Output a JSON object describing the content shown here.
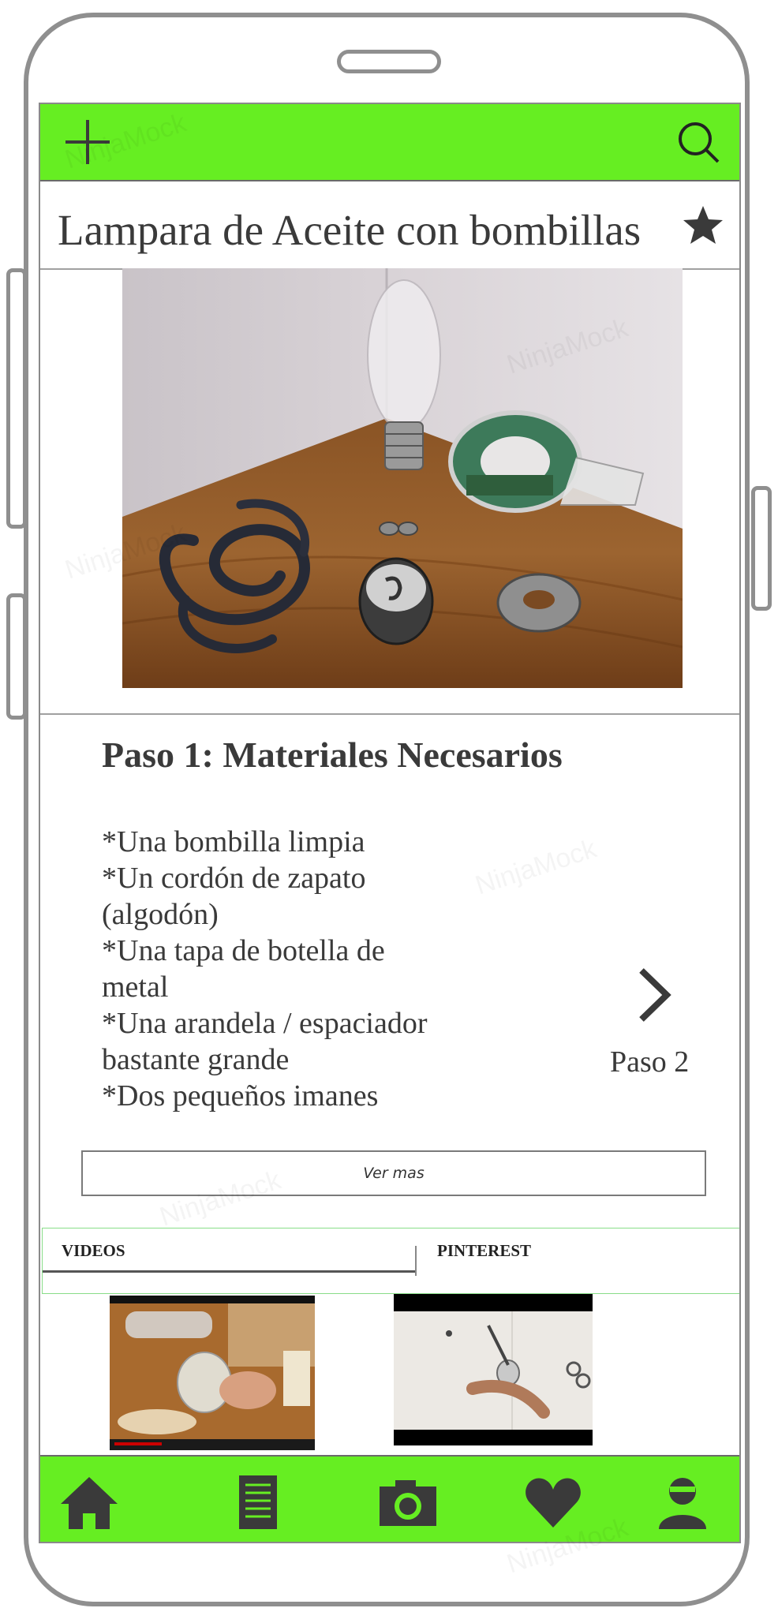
{
  "watermark": "NinjaMock",
  "header": {
    "add_icon": "plus-icon",
    "search_icon": "search-icon"
  },
  "article": {
    "title": "Lampara de Aceite con bombillas",
    "favorite_icon": "star-icon",
    "image_alt": "materials photo"
  },
  "step": {
    "title": "Paso 1: Materiales Necesarios",
    "materials": [
      "*Una bombilla limpia",
      "*Un cordón de zapato",
      "(algodón)",
      "*Una tapa de botella de",
      "metal",
      "*Una arandela / espaciador",
      "bastante grande",
      "*Dos pequeños imanes"
    ],
    "next_label": "Paso 2",
    "more_label": "Ver mas"
  },
  "tabs": {
    "videos": "VIDEOS",
    "pinterest": "PINTEREST"
  },
  "nav": {
    "items": [
      "home-icon",
      "list-icon",
      "camera-icon",
      "heart-icon",
      "user-icon"
    ]
  },
  "colors": {
    "accent": "#66ee22",
    "text": "#3a3a3a",
    "icon": "#3a3a3a"
  }
}
